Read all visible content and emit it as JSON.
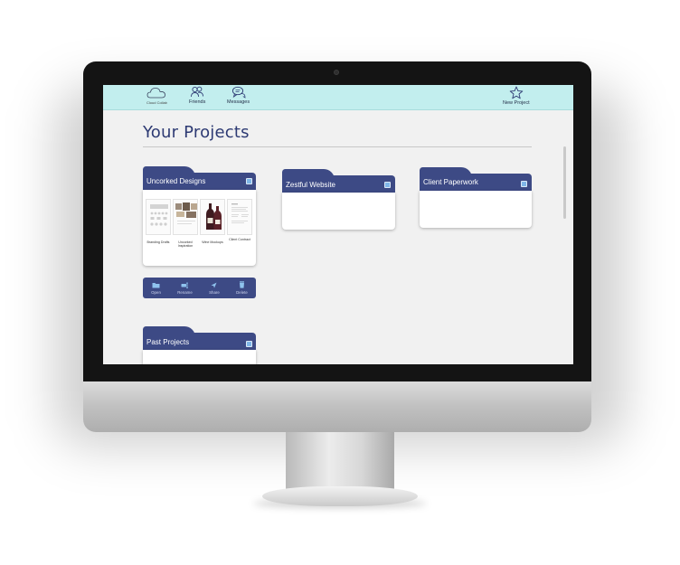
{
  "nav": {
    "brand_label": "Cloud Collab",
    "friends_label": "Friends",
    "messages_label": "Messages",
    "new_project_label": "New Project"
  },
  "page": {
    "title": "Your Projects"
  },
  "projects": [
    {
      "name": "Uncorked Designs",
      "files": [
        {
          "caption": "Branding Drafts"
        },
        {
          "caption": "Uncorked Inspiration"
        },
        {
          "caption": "Wine Mockups"
        },
        {
          "caption": "Client Contract"
        }
      ],
      "actions": [
        {
          "label": "Open",
          "icon": "folder-icon"
        },
        {
          "label": "Rename",
          "icon": "rename-icon"
        },
        {
          "label": "Share",
          "icon": "send-icon"
        },
        {
          "label": "Delete",
          "icon": "trash-icon"
        }
      ]
    },
    {
      "name": "Zestful Website"
    },
    {
      "name": "Client Paperwork"
    },
    {
      "name": "Past Projects"
    }
  ],
  "colors": {
    "nav_background": "#c2eeee",
    "folder_navy": "#3d4a85",
    "title_navy": "#2d3a73",
    "checkbox_blue": "#7fb6e8",
    "screen_background": "#f1f1f1"
  }
}
